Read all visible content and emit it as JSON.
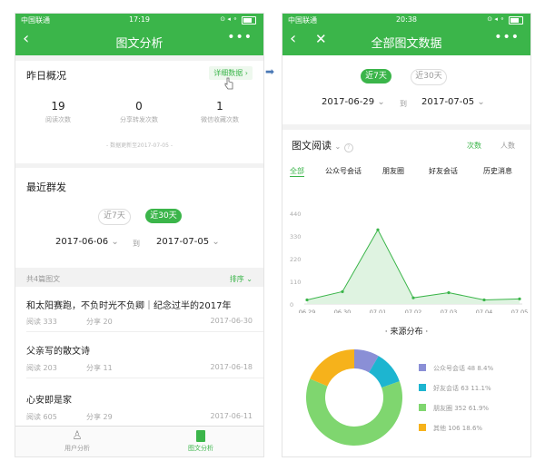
{
  "left": {
    "status": {
      "carrier": "中国联通",
      "time": "17:19"
    },
    "nav": {
      "title": "图文分析"
    },
    "overview": {
      "title": "昨日概况",
      "detail_link": "详细数据",
      "stats": [
        {
          "value": "19",
          "label": "阅读次数"
        },
        {
          "value": "0",
          "label": "分享转发次数"
        },
        {
          "value": "1",
          "label": "微信收藏次数"
        }
      ],
      "updated": "数据更新至2017-07-05"
    },
    "recent": {
      "title": "最近群发",
      "tabs": [
        "近7天",
        "近30天"
      ],
      "from": "2017-06-06",
      "sep": "到",
      "to": "2017-07-05",
      "count": "共4篇图文",
      "sort": "排序"
    },
    "articles": [
      {
        "title": "和太阳赛跑，不负时光不负卿｜纪念过半的2017年",
        "read_label": "阅读",
        "read": "333",
        "share_label": "分享",
        "share": "20",
        "date": "2017-06-30"
      },
      {
        "title": "父亲写的散文诗",
        "read_label": "阅读",
        "read": "203",
        "share_label": "分享",
        "share": "11",
        "date": "2017-06-18"
      },
      {
        "title": "心安即是家",
        "read_label": "阅读",
        "read": "605",
        "share_label": "分享",
        "share": "29",
        "date": "2017-06-11"
      }
    ],
    "tabbar": [
      "用户分析",
      "图文分析"
    ]
  },
  "right": {
    "status": {
      "carrier": "中国联通",
      "time": "20:38"
    },
    "nav": {
      "title": "全部图文数据"
    },
    "range_tabs": [
      "近7天",
      "近30天"
    ],
    "from": "2017-06-29",
    "sep": "到",
    "to": "2017-07-05",
    "section": {
      "title": "图文阅读",
      "toggle": [
        "次数",
        "人数"
      ]
    },
    "source_tabs": [
      "全部",
      "公众号会话",
      "朋友圈",
      "好友会话",
      "历史消息"
    ],
    "donut_title": "来源分布",
    "legend": [
      {
        "name": "公众号会话",
        "value": "48",
        "pct": "8.4%",
        "color": "#8a8fd6"
      },
      {
        "name": "好友会话",
        "value": "63",
        "pct": "11.1%",
        "color": "#1db5d0"
      },
      {
        "name": "朋友圈",
        "value": "352",
        "pct": "61.9%",
        "color": "#7fd66f"
      },
      {
        "name": "其他",
        "value": "106",
        "pct": "18.6%",
        "color": "#f6b21b"
      }
    ]
  },
  "chart_data": [
    {
      "type": "area",
      "x": [
        "06.29",
        "06.30",
        "07.01",
        "07.02",
        "07.03",
        "07.04",
        "07.05"
      ],
      "series": [
        {
          "values": [
            20,
            60,
            360,
            30,
            55,
            20,
            25
          ]
        }
      ],
      "yticks": [
        "440",
        "330",
        "220",
        "110",
        "0"
      ],
      "ylim": [
        0,
        440
      ],
      "grid": false,
      "color": "#3bb54a"
    },
    {
      "type": "pie",
      "title": "来源分布",
      "categories": [
        "公众号会话",
        "好友会话",
        "朋友圈",
        "其他"
      ],
      "values": [
        48,
        63,
        352,
        106
      ],
      "colors": [
        "#8a8fd6",
        "#1db5d0",
        "#7fd66f",
        "#f6b21b"
      ]
    }
  ]
}
